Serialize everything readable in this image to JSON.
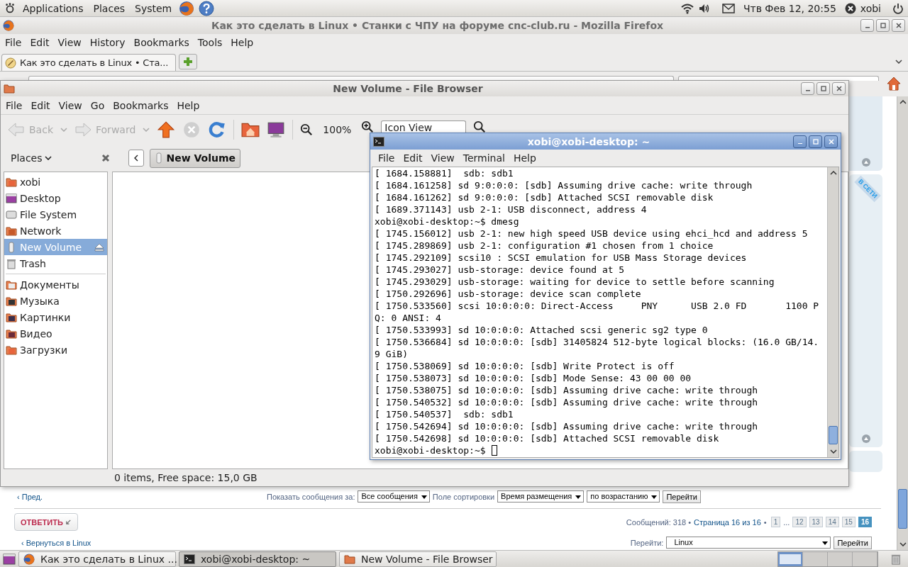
{
  "top_panel": {
    "menus": [
      "Applications",
      "Places",
      "System"
    ],
    "clock": "Чтв Фев 12, 20:55",
    "user": "xobi"
  },
  "firefox": {
    "title": "Как это сделать в Linux • Станки с ЧПУ на форуме cnc-club.ru - Mozilla Firefox",
    "menu": [
      "File",
      "Edit",
      "View",
      "History",
      "Bookmarks",
      "Tools",
      "Help"
    ],
    "tab": "Как это сделать в Linux • Ста...",
    "page": {
      "online_ribbon": "В СЕТИ",
      "prev_link": "‹ Пред.",
      "show_label": "Показать сообщения за:",
      "show_select": "Все сообщения",
      "sort_label": "Поле сортировки",
      "sort_select": "Время размещения",
      "order_select": "по возрастанию",
      "go_button": "Перейти",
      "reply_button": "ОТВЕТИТЬ",
      "post_count": "Сообщений: 318 •",
      "page_info": "Страница 16 из 16",
      "page_sep": "•",
      "pages": [
        {
          "kind": "page",
          "label": "1",
          "selected": false
        },
        {
          "kind": "gap",
          "label": "..."
        },
        {
          "kind": "page",
          "label": "12",
          "selected": false
        },
        {
          "kind": "page",
          "label": "13",
          "selected": false
        },
        {
          "kind": "page",
          "label": "14",
          "selected": false
        },
        {
          "kind": "page",
          "label": "15",
          "selected": false
        },
        {
          "kind": "page",
          "label": "16",
          "selected": true
        }
      ],
      "back_link": "‹ Вернуться в Linux",
      "jump_label": "Перейти:",
      "jump_select": "Linux",
      "jump_button": "Перейти"
    }
  },
  "file_browser": {
    "title": "New Volume - File Browser",
    "menu": [
      "File",
      "Edit",
      "View",
      "Go",
      "Bookmarks",
      "Help"
    ],
    "back": {
      "label": "Back",
      "disabled": true
    },
    "forward": {
      "label": "Forward",
      "disabled": true
    },
    "stop": {
      "disabled": true
    },
    "zoom": "100%",
    "view_mode": "Icon View",
    "places_label": "Places",
    "path_button": "New Volume",
    "sidebar_groups": [
      [
        {
          "label": "xobi",
          "kind": "home",
          "selected": false
        },
        {
          "label": "Desktop",
          "kind": "desktop",
          "selected": false
        },
        {
          "label": "File System",
          "kind": "filesystem",
          "selected": false
        },
        {
          "label": "Network",
          "kind": "network",
          "selected": false
        },
        {
          "label": "New Volume",
          "kind": "drive",
          "selected": true,
          "ejectable": true
        },
        {
          "label": "Trash",
          "kind": "trash",
          "selected": false
        }
      ],
      [
        {
          "label": "Документы",
          "kind": "documents",
          "selected": false
        },
        {
          "label": "Музыка",
          "kind": "music",
          "selected": false
        },
        {
          "label": "Картинки",
          "kind": "pictures",
          "selected": false
        },
        {
          "label": "Видео",
          "kind": "video",
          "selected": false
        },
        {
          "label": "Загрузки",
          "kind": "downloads",
          "selected": false
        }
      ]
    ],
    "status": "0 items, Free space: 15,0 GB"
  },
  "terminal": {
    "title": "xobi@xobi-desktop: ~",
    "menu": [
      "File",
      "Edit",
      "View",
      "Terminal",
      "Help"
    ],
    "lines": [
      "[ 1684.158881]  sdb: sdb1",
      "[ 1684.161258] sd 9:0:0:0: [sdb] Assuming drive cache: write through",
      "[ 1684.161262] sd 9:0:0:0: [sdb] Attached SCSI removable disk",
      "[ 1689.371143] usb 2-1: USB disconnect, address 4",
      "xobi@xobi-desktop:~$ dmesg",
      "[ 1745.156012] usb 2-1: new high speed USB device using ehci_hcd and address 5",
      "[ 1745.289869] usb 2-1: configuration #1 chosen from 1 choice",
      "[ 1745.292109] scsi10 : SCSI emulation for USB Mass Storage devices",
      "[ 1745.293027] usb-storage: device found at 5",
      "[ 1745.293029] usb-storage: waiting for device to settle before scanning",
      "[ 1750.292696] usb-storage: device scan complete",
      "[ 1750.533560] scsi 10:0:0:0: Direct-Access     PNY      USB 2.0 FD       1100 P",
      "Q: 0 ANSI: 4",
      "[ 1750.533993] sd 10:0:0:0: Attached scsi generic sg2 type 0",
      "[ 1750.536684] sd 10:0:0:0: [sdb] 31405824 512-byte logical blocks: (16.0 GB/14.",
      "9 GiB)",
      "[ 1750.538069] sd 10:0:0:0: [sdb] Write Protect is off",
      "[ 1750.538073] sd 10:0:0:0: [sdb] Mode Sense: 43 00 00 00",
      "[ 1750.538075] sd 10:0:0:0: [sdb] Assuming drive cache: write through",
      "[ 1750.540532] sd 10:0:0:0: [sdb] Assuming drive cache: write through",
      "[ 1750.540537]  sdb: sdb1",
      "[ 1750.542694] sd 10:0:0:0: [sdb] Assuming drive cache: write through",
      "[ 1750.542698] sd 10:0:0:0: [sdb] Attached SCSI removable disk"
    ],
    "prompt": "xobi@xobi-desktop:~$"
  },
  "taskbar": {
    "tasks": [
      {
        "label": "Как это сделать в Linux ...",
        "kind": "browser",
        "selected": false
      },
      {
        "label": "xobi@xobi-desktop: ~",
        "kind": "terminal",
        "selected": true
      },
      {
        "label": "New Volume - File Browser",
        "kind": "files",
        "selected": false
      }
    ]
  }
}
